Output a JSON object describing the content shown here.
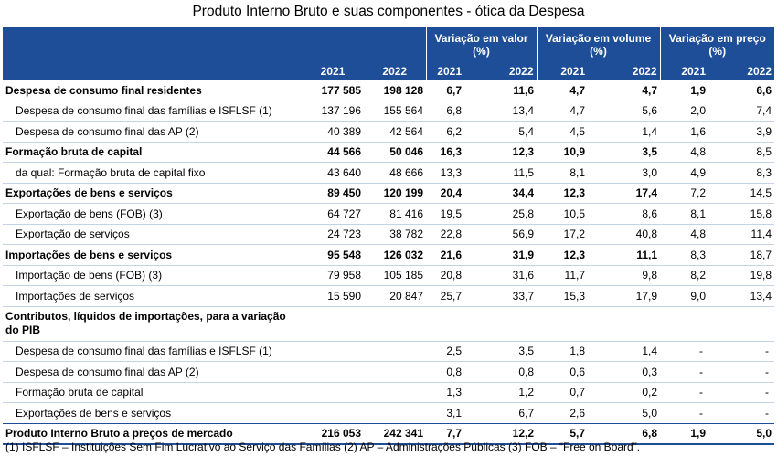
{
  "title": "Produto Interno Bruto e suas componentes - ótica da Despesa",
  "header": {
    "group_valor": "Variação em valor",
    "group_volume": "Variação em volume",
    "group_preco": "Variação em preço",
    "pct": "(%)",
    "years": [
      "2021",
      "2022"
    ]
  },
  "rows": [
    {
      "label": "Despesa de consumo final residentes",
      "v2021": "177 585",
      "v2022": "198 128",
      "val21": "6,7",
      "val22": "11,6",
      "vol21": "4,7",
      "vol22": "4,7",
      "pr21": "1,9",
      "pr22": "6,6"
    },
    {
      "label": "Despesa de consumo final das famílias e ISFLSF (1)",
      "v2021": "137 196",
      "v2022": "155 564",
      "val21": "6,8",
      "val22": "13,4",
      "vol21": "4,7",
      "vol22": "5,6",
      "pr21": "2,0",
      "pr22": "7,4"
    },
    {
      "label": "Despesa de consumo final das AP (2)",
      "v2021": "40 389",
      "v2022": "42 564",
      "val21": "6,2",
      "val22": "5,4",
      "vol21": "4,5",
      "vol22": "1,4",
      "pr21": "1,6",
      "pr22": "3,9"
    },
    {
      "label": "Formação bruta de capital",
      "v2021": "44 566",
      "v2022": "50 046",
      "val21": "16,3",
      "val22": "12,3",
      "vol21": "10,9",
      "vol22": "3,5",
      "pr21": "4,8",
      "pr22": "8,5"
    },
    {
      "label": "da qual: Formação bruta de capital fixo",
      "v2021": "43 640",
      "v2022": "48 666",
      "val21": "13,3",
      "val22": "11,5",
      "vol21": "8,1",
      "vol22": "3,0",
      "pr21": "4,9",
      "pr22": "8,3"
    },
    {
      "label": "Exportações de bens e serviços",
      "v2021": "89 450",
      "v2022": "120 199",
      "val21": "20,4",
      "val22": "34,4",
      "vol21": "12,3",
      "vol22": "17,4",
      "pr21": "7,2",
      "pr22": "14,5"
    },
    {
      "label": "Exportação de bens (FOB) (3)",
      "v2021": "64 727",
      "v2022": "81 416",
      "val21": "19,5",
      "val22": "25,8",
      "vol21": "10,5",
      "vol22": "8,6",
      "pr21": "8,1",
      "pr22": "15,8"
    },
    {
      "label": "Exportação de serviços",
      "v2021": "24 723",
      "v2022": "38 782",
      "val21": "22,8",
      "val22": "56,9",
      "vol21": "17,2",
      "vol22": "40,8",
      "pr21": "4,8",
      "pr22": "11,4"
    },
    {
      "label": "Importações de bens e serviços",
      "v2021": "95 548",
      "v2022": "126 032",
      "val21": "21,6",
      "val22": "31,9",
      "vol21": "12,3",
      "vol22": "11,1",
      "pr21": "8,3",
      "pr22": "18,7"
    },
    {
      "label": "Importação de bens (FOB) (3)",
      "v2021": "79 958",
      "v2022": "105 185",
      "val21": "20,8",
      "val22": "31,6",
      "vol21": "11,7",
      "vol22": "9,8",
      "pr21": "8,2",
      "pr22": "19,8"
    },
    {
      "label": "Importações de serviços",
      "v2021": "15 590",
      "v2022": "20 847",
      "val21": "25,7",
      "val22": "33,7",
      "vol21": "15,3",
      "vol22": "17,9",
      "pr21": "9,0",
      "pr22": "13,4"
    },
    {
      "label": "Contributos, líquidos de importações, para a variação do PIB"
    },
    {
      "label": "Despesa de consumo final das famílias e ISFLSF (1)",
      "val21": "2,5",
      "val22": "3,5",
      "vol21": "1,8",
      "vol22": "1,4",
      "pr21": "-",
      "pr22": "-"
    },
    {
      "label": "Despesa de consumo final das AP (2)",
      "val21": "0,8",
      "val22": "0,8",
      "vol21": "0,6",
      "vol22": "0,3",
      "pr21": "-",
      "pr22": "-"
    },
    {
      "label": "Formação bruta de capital",
      "val21": "1,3",
      "val22": "1,2",
      "vol21": "0,7",
      "vol22": "0,2",
      "pr21": "-",
      "pr22": "-"
    },
    {
      "label": "Exportações de bens e serviços",
      "val21": "3,1",
      "val22": "6,7",
      "vol21": "2,6",
      "vol22": "5,0",
      "pr21": "-",
      "pr22": "-"
    },
    {
      "label": "Produto Interno Bruto a preços de mercado",
      "v2021": "216 053",
      "v2022": "242 341",
      "val21": "7,7",
      "val22": "12,2",
      "vol21": "5,7",
      "vol22": "6,8",
      "pr21": "1,9",
      "pr22": "5,0"
    }
  ],
  "footnote": "(1) ISFLSF – Instituições Sem Fim Lucrativo ao Serviço das Famílias (2) AP – Administrações Públicas (3) FOB – “Free on Board”."
}
